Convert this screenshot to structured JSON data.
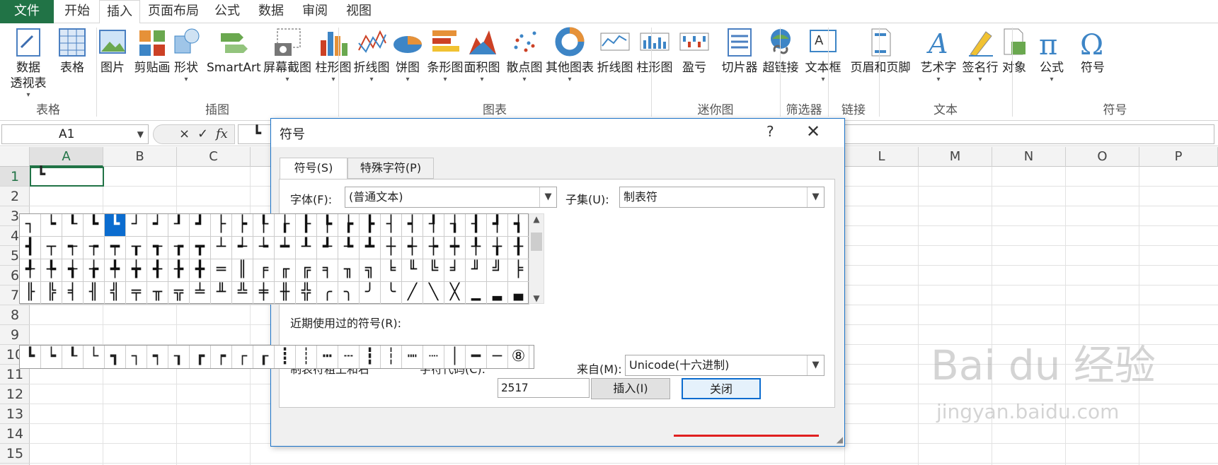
{
  "menu": {
    "items": [
      "文件",
      "开始",
      "插入",
      "页面布局",
      "公式",
      "数据",
      "审阅",
      "视图"
    ],
    "active": "插入",
    "accent": "#217346"
  },
  "ribbon": {
    "buttons": [
      {
        "label": "数据\n透视表",
        "icon": "pivot-table-icon",
        "caret": true
      },
      {
        "label": "表格",
        "icon": "table-icon",
        "caret": false
      },
      {
        "label": "图片",
        "icon": "picture-icon",
        "caret": false
      },
      {
        "label": "剪贴画",
        "icon": "clipart-icon",
        "caret": false
      },
      {
        "label": "形状",
        "icon": "shapes-icon",
        "caret": true
      },
      {
        "label": "SmartArt",
        "icon": "smartart-icon",
        "caret": false
      },
      {
        "label": "屏幕截图",
        "icon": "screenshot-icon",
        "caret": true
      },
      {
        "label": "柱形图",
        "icon": "column-chart-icon",
        "caret": true
      },
      {
        "label": "折线图",
        "icon": "line-chart-icon",
        "caret": true
      },
      {
        "label": "饼图",
        "icon": "pie-chart-icon",
        "caret": true
      },
      {
        "label": "条形图",
        "icon": "bar-chart-icon",
        "caret": true
      },
      {
        "label": "面积图",
        "icon": "area-chart-icon",
        "caret": true
      },
      {
        "label": "散点图",
        "icon": "scatter-chart-icon",
        "caret": true
      },
      {
        "label": "其他图表",
        "icon": "other-chart-icon",
        "caret": true
      },
      {
        "label": "折线图",
        "icon": "sparkline-line-icon",
        "caret": false
      },
      {
        "label": "柱形图",
        "icon": "sparkline-column-icon",
        "caret": false
      },
      {
        "label": "盈亏",
        "icon": "sparkline-winloss-icon",
        "caret": false
      },
      {
        "label": "切片器",
        "icon": "slicer-icon",
        "caret": false
      },
      {
        "label": "超链接",
        "icon": "hyperlink-icon",
        "caret": false
      },
      {
        "label": "文本框",
        "icon": "textbox-icon",
        "caret": true
      },
      {
        "label": "页眉和页脚",
        "icon": "header-footer-icon",
        "caret": false
      },
      {
        "label": "艺术字",
        "icon": "wordart-icon",
        "caret": true
      },
      {
        "label": "签名行",
        "icon": "signature-icon",
        "caret": true
      },
      {
        "label": "对象",
        "icon": "object-icon",
        "caret": false
      },
      {
        "label": "公式",
        "icon": "equation-icon",
        "caret": true
      },
      {
        "label": "符号",
        "icon": "symbol-icon",
        "caret": false
      }
    ],
    "groups": [
      "表格",
      "插图",
      "图表",
      "迷你图",
      "筛选器",
      "链接",
      "文本",
      "符号"
    ]
  },
  "formula_bar": {
    "name_box": "A1",
    "buttons": [
      "×",
      "✓",
      "fx"
    ],
    "content": "┗"
  },
  "sheet": {
    "columns": [
      "A",
      "B",
      "C",
      "L",
      "M",
      "N",
      "O",
      "P"
    ],
    "rows": [
      "1",
      "2",
      "3",
      "4",
      "5",
      "6",
      "7",
      "8",
      "9",
      "10",
      "11",
      "12",
      "13",
      "14",
      "15"
    ],
    "a1_value": "┗"
  },
  "dialog": {
    "title": "符号",
    "help": "?",
    "close": "✕",
    "tabs": [
      "符号(S)",
      "特殊字符(P)"
    ],
    "font_label": "字体(F):",
    "font_value": "(普通文本)",
    "subset_label": "子集(U):",
    "subset_value": "制表符",
    "symbol_rows": [
      [
        "┐",
        "┕",
        "┖",
        "┗",
        "┗",
        "┘",
        "┙",
        "┚",
        "┛",
        "├",
        "┝",
        "┞",
        "┟",
        "┠",
        "┡",
        "┢",
        "┣",
        "┤",
        "┥",
        "┦",
        "┧",
        "┨",
        "┩",
        "┪"
      ],
      [
        "┫",
        "┬",
        "┭",
        "┮",
        "┯",
        "┰",
        "┱",
        "┲",
        "┳",
        "┴",
        "┵",
        "┶",
        "┷",
        "┸",
        "┹",
        "┺",
        "┻",
        "┼",
        "┽",
        "┾",
        "┿",
        "╀",
        "╁",
        "╂"
      ],
      [
        "╃",
        "╄",
        "╅",
        "╆",
        "╇",
        "╈",
        "╉",
        "╊",
        "╋",
        "═",
        "║",
        "╒",
        "╓",
        "╔",
        "╕",
        "╖",
        "╗",
        "╘",
        "╙",
        "╚",
        "╛",
        "╜",
        "╝",
        "╞"
      ],
      [
        "╟",
        "╠",
        "╡",
        "╢",
        "╣",
        "╤",
        "╥",
        "╦",
        "╧",
        "╨",
        "╩",
        "╪",
        "╫",
        "╬",
        "╭",
        "╮",
        "╯",
        "╰",
        "╱",
        "╲",
        "╳",
        "▁",
        "▂",
        "▃"
      ]
    ],
    "selected_symbol": "┗",
    "recent_label": "近期使用过的符号(R):",
    "recent_symbols": [
      "┗",
      "┕",
      "┖",
      "└",
      "┓",
      "┐",
      "┑",
      "┒",
      "┏",
      "┍",
      "┌",
      "┎",
      "┋",
      "┊",
      "┅",
      "┄",
      "┇",
      "┆",
      "┉",
      "┈",
      "│",
      "━",
      "─",
      "⑧"
    ],
    "symbol_name": "制表符粗上和右",
    "code_label": "字符代码(C):",
    "code_value": "2517",
    "from_label": "来自(M):",
    "from_value": "Unicode(十六进制)",
    "insert_button": "插入(I)",
    "close_button": "关闭"
  },
  "watermark": {
    "line1": "Bai du 经验",
    "line2": "jingyan.baidu.com"
  }
}
